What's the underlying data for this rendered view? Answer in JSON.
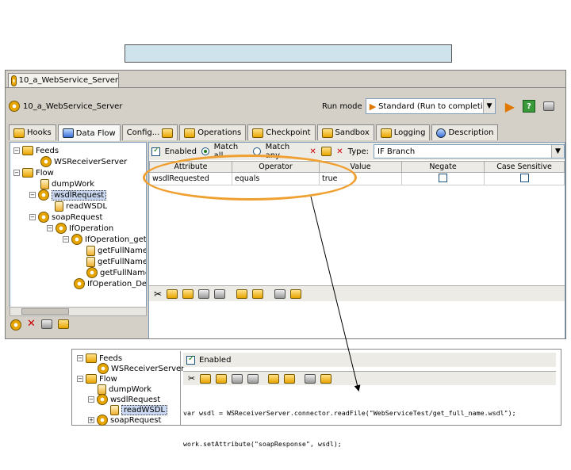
{
  "window": {
    "doc_tab": "10_a_WebService_Server",
    "title": "10_a_WebService_Server"
  },
  "toolbar": {
    "run_mode_label": "Run mode",
    "run_mode_value": "Standard (Run to completion)"
  },
  "tabs": [
    {
      "label": "Hooks"
    },
    {
      "label": "Data Flow"
    },
    {
      "label": "Config..."
    },
    {
      "label": "Operations"
    },
    {
      "label": "Checkpoint"
    },
    {
      "label": "Sandbox"
    },
    {
      "label": "Logging"
    },
    {
      "label": "Description"
    }
  ],
  "tree": {
    "feeds": "Feeds",
    "ws_receiver": "WSReceiverServer",
    "flow": "Flow",
    "dump_work": "dumpWork",
    "wsdl_request": "wsdlRequest",
    "read_wsdl": "readWSDL",
    "soap_request": "soapRequest",
    "if_operation": "IfOperation",
    "if_operation_get": "IfOperation_getF",
    "get_full_name_1": "getFullName",
    "get_full_name_2": "getFullName",
    "get_full_name_3": "getFullName",
    "if_operation_default": "IfOperation_Defa"
  },
  "options": {
    "enabled_label": "Enabled",
    "match_all_label": "Match all",
    "match_any_label": "Match any",
    "type_label": "Type:",
    "type_value": "IF Branch"
  },
  "grid": {
    "headers": [
      "Attribute",
      "Operator",
      "Value",
      "Negate",
      "Case Sensitive"
    ],
    "rows": [
      {
        "attribute": "wsdlRequested",
        "operator": "equals",
        "value": "true"
      }
    ]
  },
  "zoom": {
    "tree": {
      "feeds": "Feeds",
      "ws_receiver": "WSReceiverServer",
      "flow": "Flow",
      "dump_work": "dumpWork",
      "wsdl_request": "wsdlRequest",
      "read_wsdl": "readWSDL",
      "soap_request": "soapRequest"
    },
    "enabled_label": "Enabled",
    "code_line_1": "var wsdl = WSReceiverServer.connector.readFile(\"WebServiceTest/get_full_name.wsdl\");",
    "code_line_2": "work.setAttribute(\"soapResponse\", wsdl);"
  },
  "colors": {
    "highlight_ellipse": "#f0a030",
    "banner": "#cfe3ec"
  }
}
